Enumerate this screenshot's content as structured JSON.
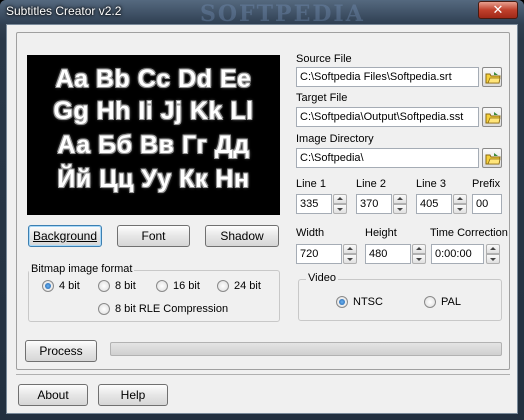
{
  "window": {
    "title": "Subtitles Creator v2.2",
    "close_glyph": "✕",
    "watermark": "SOFTPEDIA"
  },
  "preview": {
    "lines": [
      "Aa Bb Cc Dd Ee",
      "Gg Hh Ii Jj Kk Ll",
      "Аа Бб Вв Гг Дд",
      "Йй Цц Уу Кк Нн"
    ],
    "background": "#000000",
    "text_color": "#ffffff"
  },
  "buttons": {
    "background": "Background",
    "font": "Font",
    "shadow": "Shadow",
    "process": "Process",
    "about": "About",
    "help": "Help"
  },
  "bitmap_format": {
    "legend": "Bitmap image format",
    "options": [
      "4 bit",
      "8 bit",
      "16 bit",
      "24 bit",
      "8 bit RLE Compression"
    ],
    "selected": "4 bit"
  },
  "source_file": {
    "label": "Source File",
    "value": "C:\\Softpedia Files\\Softpedia.srt"
  },
  "target_file": {
    "label": "Target File",
    "value": "C:\\Softpedia\\Output\\Softpedia.sst"
  },
  "image_directory": {
    "label": "Image Directory",
    "value": "C:\\Softpedia\\"
  },
  "lines": {
    "line1": {
      "label": "Line 1",
      "value": "335"
    },
    "line2": {
      "label": "Line 2",
      "value": "370"
    },
    "line3": {
      "label": "Line 3",
      "value": "405"
    },
    "prefix": {
      "label": "Prefix",
      "value": "00"
    }
  },
  "dimensions": {
    "width": {
      "label": "Width",
      "value": "720"
    },
    "height": {
      "label": "Height",
      "value": "480"
    },
    "time_correction": {
      "label": "Time Correction",
      "value": "0:00:00"
    }
  },
  "video": {
    "legend": "Video",
    "options": [
      "NTSC",
      "PAL"
    ],
    "selected": "NTSC"
  },
  "progress": {
    "fraction": 0
  },
  "colors": {
    "progress": "#3cb83c",
    "accent": "#1d5fa8"
  }
}
